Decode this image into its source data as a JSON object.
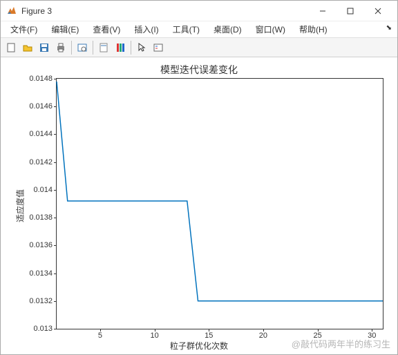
{
  "window": {
    "title": "Figure 3"
  },
  "menu": {
    "file": "文件(F)",
    "edit": "编辑(E)",
    "view": "查看(V)",
    "insert": "插入(I)",
    "tools": "工具(T)",
    "desktop": "桌面(D)",
    "window": "窗口(W)",
    "help": "帮助(H)"
  },
  "chart_data": {
    "type": "line",
    "title": "模型迭代误差变化",
    "xlabel": "粒子群优化次数",
    "ylabel": "适应度值",
    "xlim": [
      1,
      31
    ],
    "ylim": [
      0.013,
      0.0148
    ],
    "xticks": [
      5,
      10,
      15,
      20,
      25,
      30
    ],
    "yticks": [
      0.013,
      0.0132,
      0.0134,
      0.0136,
      0.0138,
      0.014,
      0.0142,
      0.0144,
      0.0146,
      0.0148
    ],
    "x": [
      1,
      2,
      3,
      4,
      5,
      6,
      7,
      8,
      9,
      10,
      11,
      12,
      13,
      14,
      15,
      16,
      17,
      18,
      19,
      20,
      21,
      22,
      23,
      24,
      25,
      26,
      27,
      28,
      29,
      30,
      31
    ],
    "y": [
      0.01478,
      0.01392,
      0.01392,
      0.01392,
      0.01392,
      0.01392,
      0.01392,
      0.01392,
      0.01392,
      0.01392,
      0.01392,
      0.01392,
      0.01392,
      0.0132,
      0.0132,
      0.0132,
      0.0132,
      0.0132,
      0.0132,
      0.0132,
      0.0132,
      0.0132,
      0.0132,
      0.0132,
      0.0132,
      0.0132,
      0.0132,
      0.0132,
      0.0132,
      0.0132,
      0.0132
    ]
  },
  "watermark": "@敲代码两年半的练习生"
}
